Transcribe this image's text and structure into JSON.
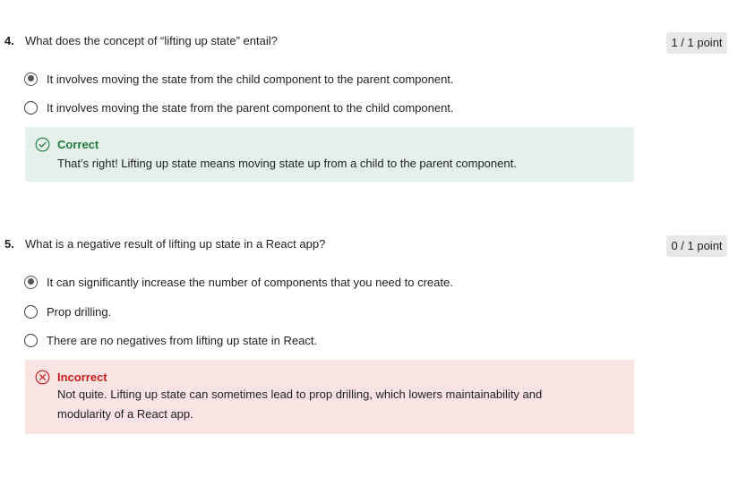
{
  "questions": [
    {
      "number": "4.",
      "text": "What does the concept of “lifting up state” entail?",
      "points": "1 / 1 point",
      "options": [
        {
          "label": "It involves moving the state from the child component to the parent component.",
          "selected": true
        },
        {
          "label": "It involves moving the state from the parent component to the child component.",
          "selected": false
        }
      ],
      "feedback": {
        "status": "correct",
        "title": "Correct",
        "body": "That’s right! Lifting up state means moving state up from a child to the parent component.",
        "icon": "check-circle-icon",
        "color": "#1e7b3c"
      }
    },
    {
      "number": "5.",
      "text": "What is a negative result of lifting up state in a React app?",
      "points": "0 / 1 point",
      "options": [
        {
          "label": "It can significantly increase the number of components that you need to create.",
          "selected": true
        },
        {
          "label": "Prop drilling.",
          "selected": false
        },
        {
          "label": "There are no negatives from lifting up state in React.",
          "selected": false
        }
      ],
      "feedback": {
        "status": "incorrect",
        "title": "Incorrect",
        "body": "Not quite. Lifting up state can sometimes lead to prop drilling, which lowers maintainability and modularity of a React app.",
        "icon": "x-circle-icon",
        "color": "#c81d1d"
      }
    }
  ]
}
